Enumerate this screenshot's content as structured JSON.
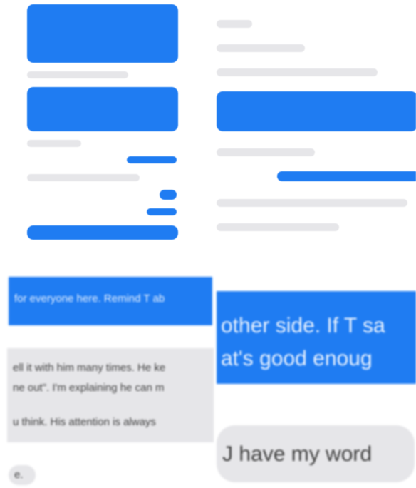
{
  "tiles": {
    "left_small": {
      "messages": [
        {
          "type": "out",
          "text": "",
          "time": ""
        },
        {
          "type": "in",
          "text": "",
          "time": ""
        },
        {
          "type": "out",
          "text": "",
          "time": ""
        },
        {
          "type": "in",
          "text": "",
          "time": ""
        },
        {
          "type": "out",
          "text": "",
          "time": ""
        },
        {
          "type": "in",
          "text": "",
          "time": ""
        },
        {
          "type": "out",
          "text": "",
          "time": ""
        },
        {
          "type": "out",
          "text": "",
          "time": ""
        },
        {
          "type": "out",
          "text": "",
          "time": ""
        }
      ]
    },
    "right_small": {
      "messages": [
        {
          "type": "in",
          "text": "",
          "time": ""
        },
        {
          "type": "in",
          "text": "",
          "time": ""
        },
        {
          "type": "in",
          "text": "",
          "time": ""
        },
        {
          "type": "out",
          "text": "",
          "time": ""
        },
        {
          "type": "in",
          "text": "",
          "time": ""
        },
        {
          "type": "out",
          "text": "",
          "time": ""
        },
        {
          "type": "in",
          "text": "",
          "time": ""
        },
        {
          "type": "in",
          "text": "",
          "time": ""
        }
      ]
    },
    "left_zoom": {
      "out_line": "for everyone here. Remind T ab",
      "in_lines": [
        "ell it with him many times. He ke",
        "ne out\". I'm explaining he can m",
        "u think. His attention is always"
      ],
      "small_in": "e."
    },
    "right_zoom": {
      "out_lines": [
        "other side. If T sa",
        "at's good enoug"
      ],
      "in_line": "J have my word"
    }
  },
  "colors": {
    "sent_bubble": "#1f7cf2",
    "received_bubble": "#e6e6e9",
    "background": "#ffffff"
  }
}
